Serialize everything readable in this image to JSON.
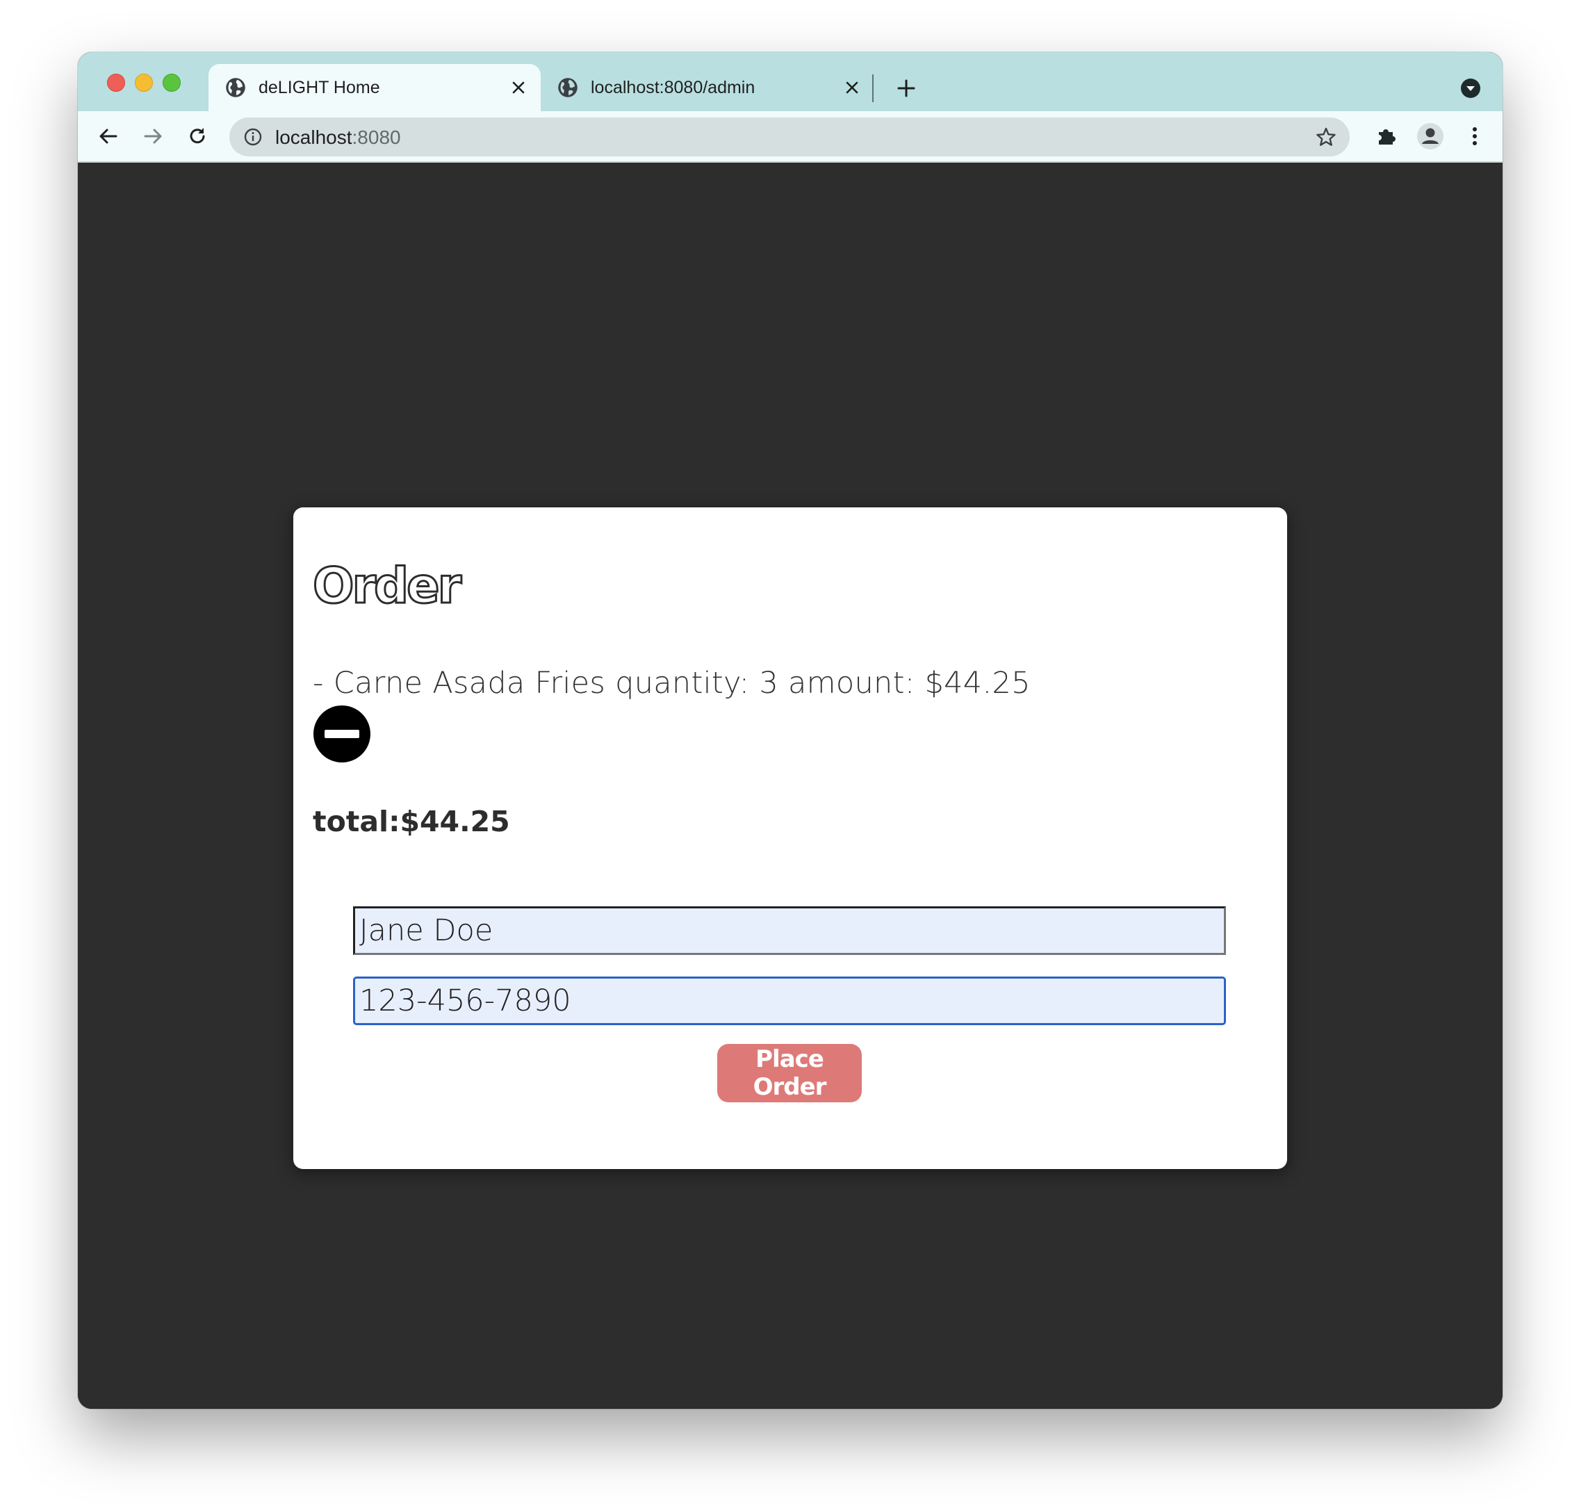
{
  "browser": {
    "tabs": [
      {
        "title": "deLIGHT Home",
        "active": true
      },
      {
        "title": "localhost:8080/admin",
        "active": false
      }
    ],
    "address": {
      "host": "localhost",
      "port": ":8080"
    }
  },
  "page": {
    "heading": "Order",
    "items": [
      {
        "line": "- Carne Asada Fries quantity: 3 amount: $44.25"
      }
    ],
    "total": "total:$44.25",
    "form": {
      "name_value": "Jane Doe",
      "phone_value": "123-456-7890",
      "submit_label": "Place Order"
    }
  },
  "colors": {
    "tabbar": "#b9dfe0",
    "page_background": "#2d2d2d",
    "button": "#dd7a78",
    "input_fill": "#e8effc",
    "focus_border": "#2a62c9"
  },
  "icons": [
    "globe-icon",
    "close-icon",
    "plus-icon",
    "chevron-down-icon",
    "back-arrow-icon",
    "forward-arrow-icon",
    "reload-icon",
    "info-icon",
    "star-icon",
    "puzzle-icon",
    "profile-icon",
    "more-vert-icon",
    "minus-circle-icon"
  ]
}
